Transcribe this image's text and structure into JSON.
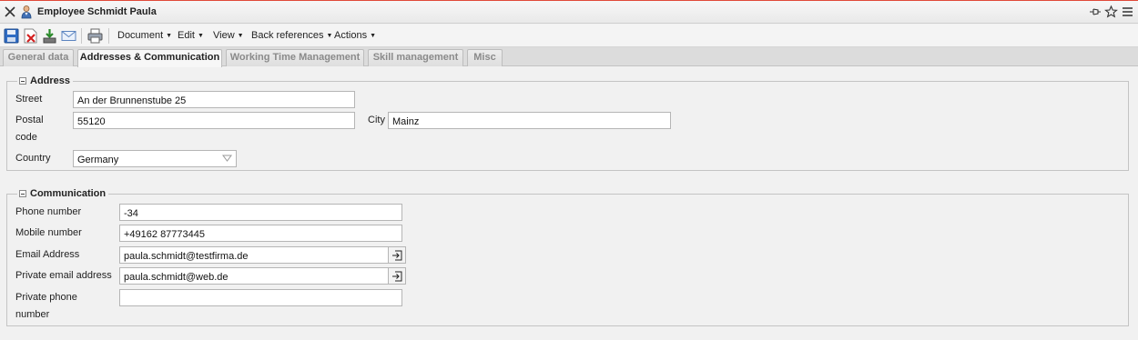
{
  "window": {
    "title": "Employee Schmidt Paula"
  },
  "toolbar": {
    "icons": [
      "save-icon",
      "delete-icon",
      "download-icon",
      "email-icon",
      "print-icon"
    ],
    "menus": [
      {
        "label": "Document"
      },
      {
        "label": "Edit"
      },
      {
        "label": "View"
      },
      {
        "label": "Back references"
      },
      {
        "label": "Actions"
      }
    ]
  },
  "tabs": [
    {
      "label": "General data",
      "active": false
    },
    {
      "label": "Addresses & Communication",
      "active": true
    },
    {
      "label": "Working Time Management",
      "active": false
    },
    {
      "label": "Skill management",
      "active": false
    },
    {
      "label": "Misc",
      "active": false
    }
  ],
  "address": {
    "legend": "Address",
    "street_label": "Street",
    "street_value": "An der Brunnenstube 25",
    "postal_label_1": "Postal",
    "postal_label_2": "code",
    "postal_value": "55120",
    "city_label": "City",
    "city_value": "Mainz",
    "country_label": "Country",
    "country_value": "Germany"
  },
  "communication": {
    "legend": "Communication",
    "phone_label": "Phone number",
    "phone_value": "-34",
    "mobile_label": "Mobile number",
    "mobile_value": "+49162 87773445",
    "email_label": "Email Address",
    "email_value": "paula.schmidt@testfirma.de",
    "private_email_label": "Private email address",
    "private_email_value": "paula.schmidt@web.de",
    "private_phone_label_1": "Private phone",
    "private_phone_label_2": "number",
    "private_phone_value": ""
  }
}
